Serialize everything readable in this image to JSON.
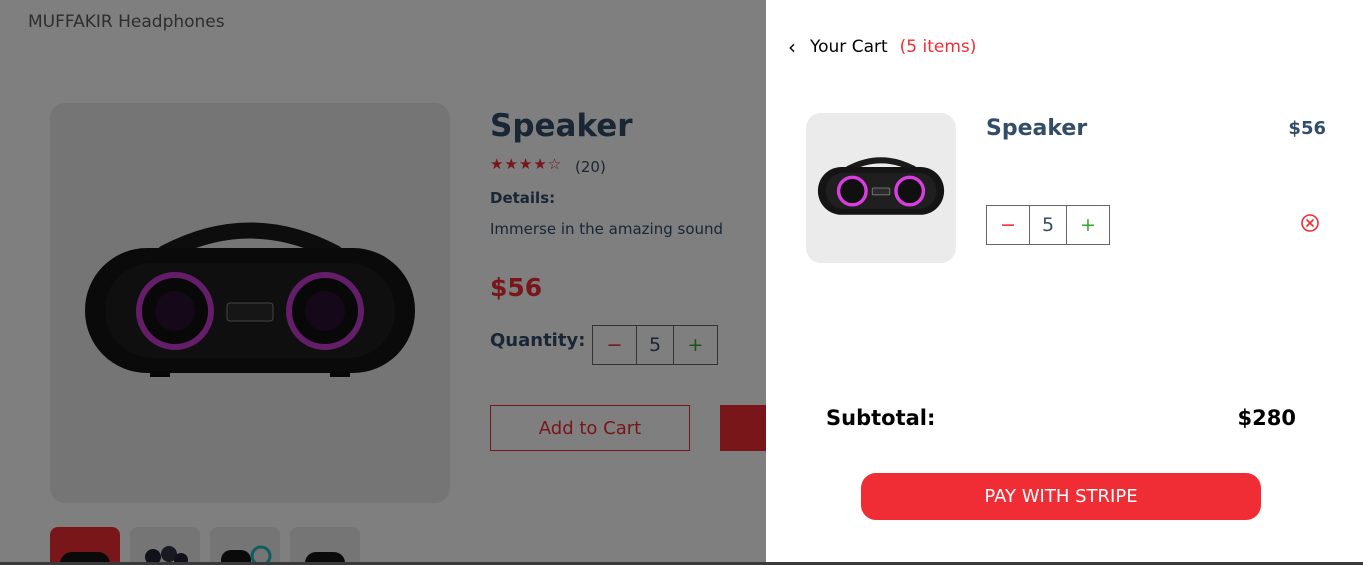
{
  "page": {
    "logo": "MUFFAKIR Headphones",
    "product": {
      "name": "Speaker",
      "rating_stars": 4,
      "stars_display": "★★★★☆",
      "reviews": "(20)",
      "details_label": "Details:",
      "details": "Immerse in the amazing sound",
      "price": "$56",
      "quantity_label": "Quantity:",
      "quantity": "5",
      "add_to_cart": "Add to Cart"
    }
  },
  "cart": {
    "heading": "Your Cart",
    "count": "(5 items)",
    "items": [
      {
        "name": "Speaker",
        "price": "$56",
        "quantity": "5"
      }
    ],
    "subtotal_label": "Subtotal:",
    "subtotal": "$280",
    "pay_button": "PAY WITH STRIPE"
  },
  "icons": {
    "minus": "−",
    "plus": "+",
    "back": "‹"
  },
  "colors": {
    "accent": "#f02d34",
    "text_dark": "#324d67",
    "plus_green": "#31a831"
  }
}
